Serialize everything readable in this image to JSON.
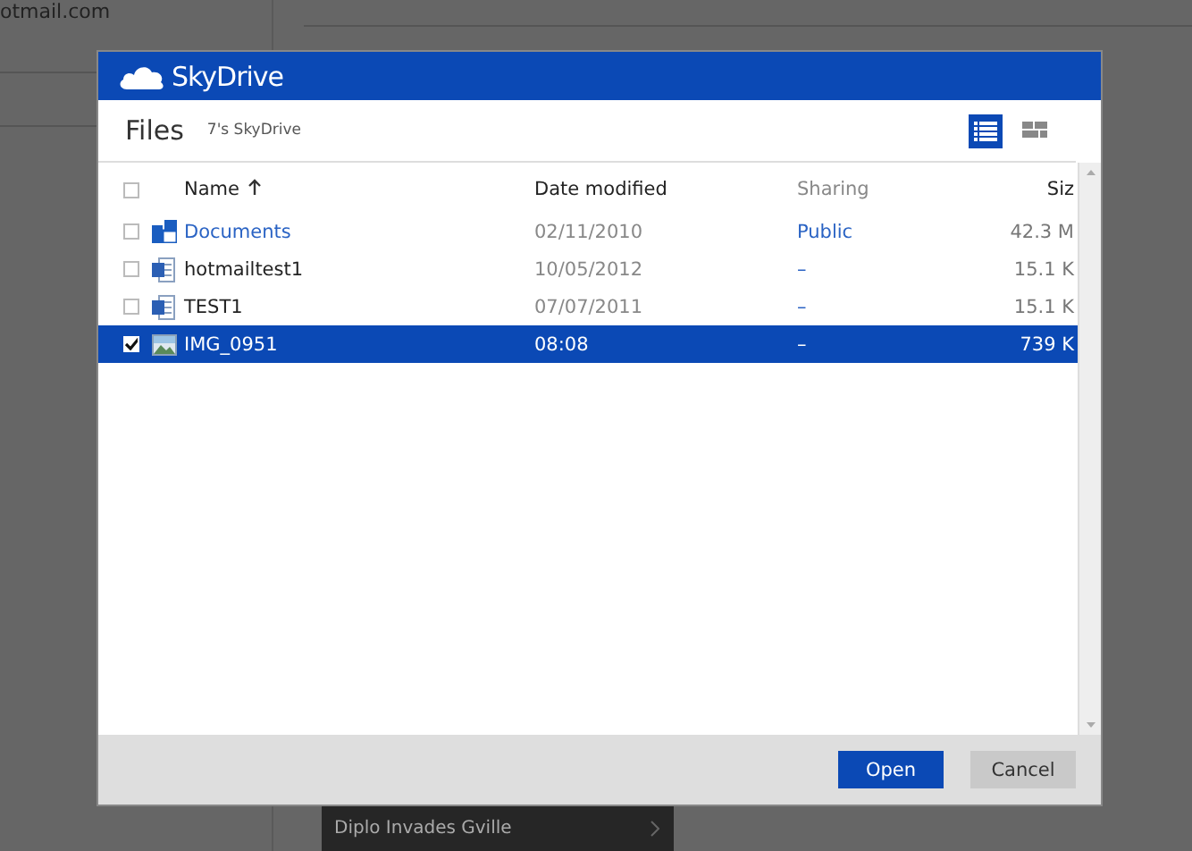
{
  "background": {
    "account_text": "otmail.com",
    "playlist_item": "Diplo Invades Gville"
  },
  "dialog": {
    "brand": "SkyDrive",
    "title": "Files",
    "location": "7's SkyDrive",
    "views": [
      {
        "kind": "details",
        "selected": true
      },
      {
        "kind": "thumbnails",
        "selected": false
      }
    ],
    "table": {
      "select_all": {
        "checked": false
      },
      "columns": [
        {
          "label": "Name",
          "sorted": true
        },
        {
          "label": "Date modified",
          "sorted": false
        },
        {
          "label": "Sharing",
          "sorted": false
        },
        {
          "label": "Siz",
          "sorted": false
        }
      ],
      "rows": [
        {
          "kind": "folder",
          "name": "Documents",
          "date": "02/11/2010",
          "sharing": "Public",
          "size": "42.3 M",
          "checked": false,
          "selected": false
        },
        {
          "kind": "document",
          "name": "hotmailtest1",
          "date": "10/05/2012",
          "sharing": "–",
          "size": "15.1 K",
          "checked": false,
          "selected": false
        },
        {
          "kind": "document",
          "name": "TEST1",
          "date": "07/07/2011",
          "sharing": "–",
          "size": "15.1 K",
          "checked": false,
          "selected": false
        },
        {
          "kind": "image",
          "name": "IMG_0951",
          "date": "08:08",
          "sharing": "–",
          "size": "739 K",
          "checked": true,
          "selected": true
        }
      ]
    },
    "buttons": [
      {
        "label": "Open",
        "kind": "primary"
      },
      {
        "label": "Cancel",
        "kind": "secondary"
      }
    ]
  }
}
